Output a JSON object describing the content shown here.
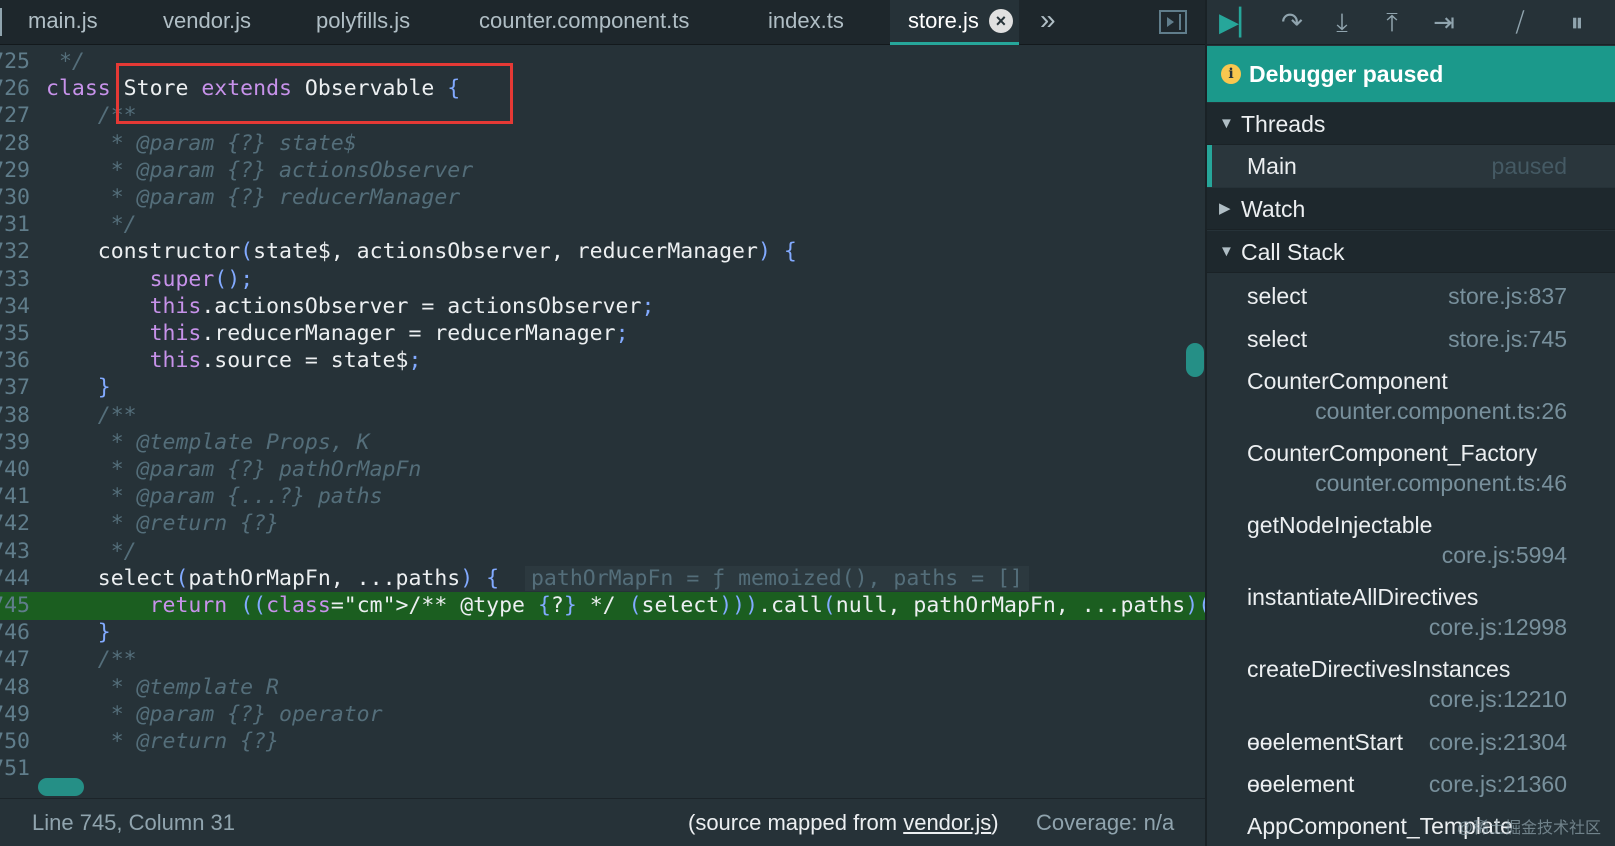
{
  "tabs": [
    {
      "label": "main.js"
    },
    {
      "label": "vendor.js"
    },
    {
      "label": "polyfills.js"
    },
    {
      "label": "counter.component.ts"
    },
    {
      "label": "index.ts"
    },
    {
      "label": "store.js",
      "active": true
    }
  ],
  "more_tabs_icon": "»",
  "code_lines": [
    {
      "num": "725",
      "text": " */"
    },
    {
      "num": "726",
      "text": "class Store extends Observable {"
    },
    {
      "num": "727",
      "text": "    /**"
    },
    {
      "num": "728",
      "text": "     * @param {?} state$"
    },
    {
      "num": "729",
      "text": "     * @param {?} actionsObserver"
    },
    {
      "num": "730",
      "text": "     * @param {?} reducerManager"
    },
    {
      "num": "731",
      "text": "     */"
    },
    {
      "num": "732",
      "text": "    constructor(state$, actionsObserver, reducerManager) {"
    },
    {
      "num": "733",
      "text": "        super();"
    },
    {
      "num": "734",
      "text": "        this.actionsObserver = actionsObserver;"
    },
    {
      "num": "735",
      "text": "        this.reducerManager = reducerManager;"
    },
    {
      "num": "736",
      "text": "        this.source = state$;"
    },
    {
      "num": "737",
      "text": "    }"
    },
    {
      "num": "738",
      "text": "    /**"
    },
    {
      "num": "739",
      "text": "     * @template Props, K"
    },
    {
      "num": "740",
      "text": "     * @param {?} pathOrMapFn"
    },
    {
      "num": "741",
      "text": "     * @param {...?} paths"
    },
    {
      "num": "742",
      "text": "     * @return {?}"
    },
    {
      "num": "743",
      "text": "     */"
    },
    {
      "num": "744",
      "text": "    select(pathOrMapFn, ...paths) {",
      "inline": "pathOrMapFn = ƒ memoized(), paths = []"
    },
    {
      "num": "745",
      "text": "        return ((/** @type {?} */ (select))).call(null, pathOrMapFn, ...paths)(this);",
      "paused": true
    },
    {
      "num": "746",
      "text": "    }"
    },
    {
      "num": "747",
      "text": "    /**"
    },
    {
      "num": "748",
      "text": "     * @template R"
    },
    {
      "num": "749",
      "text": "     * @param {?} operator"
    },
    {
      "num": "750",
      "text": "     * @return {?}"
    },
    {
      "num": "751",
      "text": ""
    }
  ],
  "status": {
    "position": "Line 745, Column 31",
    "source_prefix": "(source mapped from ",
    "source_file": "vendor.js",
    "source_suffix": ")",
    "coverage": "Coverage: n/a"
  },
  "debugger": {
    "toolbar": [
      "resume-icon",
      "step-over-icon",
      "step-in-icon",
      "step-out-icon",
      "step-icon",
      "deactivate-breakpoints-icon",
      "pause-exceptions-icon"
    ],
    "banner": "Debugger paused",
    "threads_label": "Threads",
    "thread_name": "Main",
    "thread_status": "paused",
    "watch_label": "Watch",
    "callstack_label": "Call Stack",
    "frames": [
      {
        "name": "select",
        "location": "store.js:837"
      },
      {
        "name": "select",
        "location": "store.js:745"
      },
      {
        "name": "CounterComponent",
        "location": "counter.component.ts:26"
      },
      {
        "name": "CounterComponent_Factory",
        "location": "counter.component.ts:46"
      },
      {
        "name": "getNodeInjectable",
        "location": "core.js:5994"
      },
      {
        "name": "instantiateAllDirectives",
        "location": "core.js:12998"
      },
      {
        "name": "createDirectivesInstances",
        "location": "core.js:12210"
      },
      {
        "name": "ɵɵelementStart",
        "location": "core.js:21304"
      },
      {
        "name": "ɵɵelement",
        "location": "core.js:21360"
      },
      {
        "name": "AppComponent_Template",
        "location": ""
      }
    ]
  },
  "watermark": "@稀土掘金技术社区"
}
